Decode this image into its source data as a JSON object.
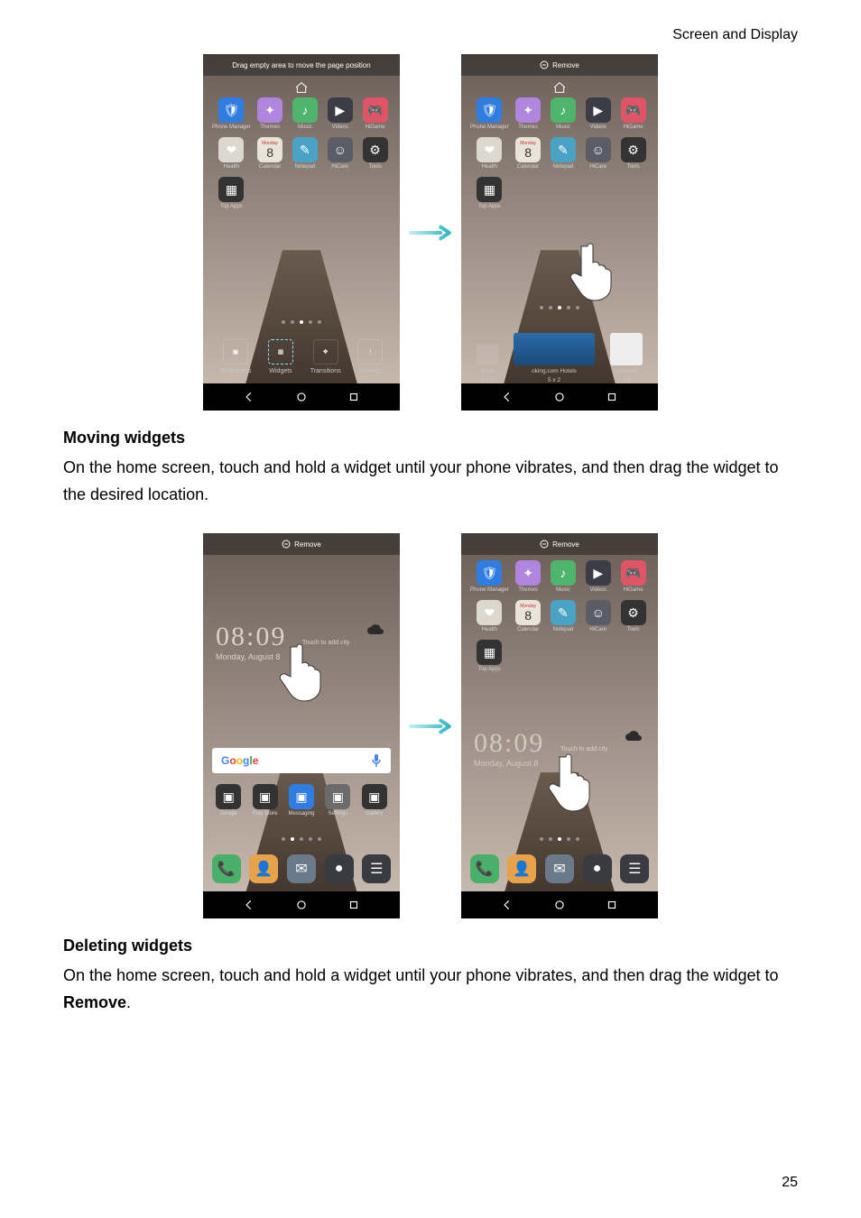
{
  "header": "Screen and Display",
  "page_number": "25",
  "section1": {
    "heading": "Moving widgets",
    "text": "On the home screen, touch and hold a widget until your phone vibrates, and then drag the widget to the desired location."
  },
  "section2": {
    "heading": "Deleting widgets",
    "text_a": "On the home screen, touch and hold a widget until your phone vibrates, and then drag the widget to ",
    "bold": "Remove",
    "text_b": "."
  },
  "fig1": {
    "left_top": "Drag empty area to move the page position",
    "right_top": "Remove",
    "apps": [
      {
        "label": "Phone Manager",
        "color": "#2f7de0",
        "glyph": "🛡"
      },
      {
        "label": "Themes",
        "color": "#b085e0",
        "glyph": "✦"
      },
      {
        "label": "Music",
        "color": "#4fb56a",
        "glyph": "♪"
      },
      {
        "label": "Videos",
        "color": "#3c3c46",
        "glyph": "▶"
      },
      {
        "label": "HiGame",
        "color": "#e05566",
        "glyph": "🎮"
      },
      {
        "label": "Health",
        "color": "#dcd7cf",
        "glyph": "❤"
      },
      {
        "label": "Calendar",
        "color": "#e9e4da",
        "glyph": "8"
      },
      {
        "label": "Notepad",
        "color": "#4aa3c4",
        "glyph": "✎"
      },
      {
        "label": "HiCare",
        "color": "#5c5c66",
        "glyph": "☺"
      },
      {
        "label": "Tools",
        "color": "#333",
        "glyph": "⚙"
      },
      {
        "label": "Top Apps",
        "color": "#333",
        "glyph": "▦"
      }
    ],
    "day": "Monday",
    "daynum": "8",
    "tools": [
      {
        "label": "Wallpapers"
      },
      {
        "label": "Widgets"
      },
      {
        "label": "Transitions"
      },
      {
        "label": "Settings"
      }
    ],
    "widgets": [
      {
        "label": "Book",
        "sub": "1 x 1"
      },
      {
        "label": "oking.com Hotels",
        "sub": "5 x 2"
      },
      {
        "label": "Calendar",
        "sub": "(2)"
      }
    ]
  },
  "fig2": {
    "top": "Remove",
    "time": "08:09",
    "date": "Monday, August 8",
    "addcity": "Touch to add city",
    "google": "Google",
    "dock_apps": [
      {
        "label": "Google",
        "color": "#333"
      },
      {
        "label": "Play Store",
        "color": "#333"
      },
      {
        "label": "Messaging",
        "color": "#2f7de0"
      },
      {
        "label": "Settings",
        "color": "#6b6b6b"
      },
      {
        "label": "Gallery",
        "color": "#333"
      }
    ],
    "bottom_dock": [
      {
        "glyph": "📞",
        "color": "#49b06a"
      },
      {
        "glyph": "👤",
        "color": "#e8a24a"
      },
      {
        "glyph": "✉",
        "color": "#6a7a8a"
      },
      {
        "glyph": "●",
        "color": "#3a3a42"
      },
      {
        "glyph": "☰",
        "color": "#3a3a42"
      }
    ]
  }
}
